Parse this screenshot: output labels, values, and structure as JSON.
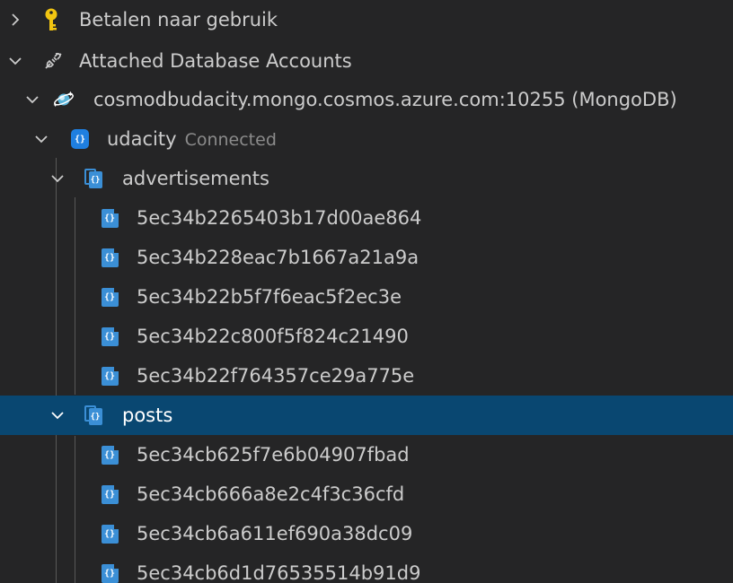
{
  "tree": {
    "subscription": {
      "label": "Betalen naar gebruik",
      "icon": "key-icon",
      "color": "#f2c511"
    },
    "attached": {
      "label": "Attached Database Accounts",
      "icon": "plug-icon"
    },
    "account": {
      "label": "cosmodbudacity.mongo.cosmos.azure.com:10255 (MongoDB)",
      "icon": "cosmos-db-icon"
    },
    "database": {
      "label": "udacity",
      "status": "Connected",
      "icon": "database-icon"
    },
    "collections": [
      {
        "label": "advertisements",
        "documents": [
          "5ec34b2265403b17d00ae864",
          "5ec34b228eac7b1667a21a9a",
          "5ec34b22b5f7f6eac5f2ec3e",
          "5ec34b22c800f5f824c21490",
          "5ec34b22f764357ce29a775e"
        ]
      },
      {
        "label": "posts",
        "documents": [
          "5ec34cb625f7e6b04907fbad",
          "5ec34cb666a8e2c4f3c36cfd",
          "5ec34cb6a611ef690a38dc09",
          "5ec34cb6d1d76535514b91d9"
        ]
      }
    ],
    "icon_glyph": "{}",
    "selection_color": "#094771"
  }
}
